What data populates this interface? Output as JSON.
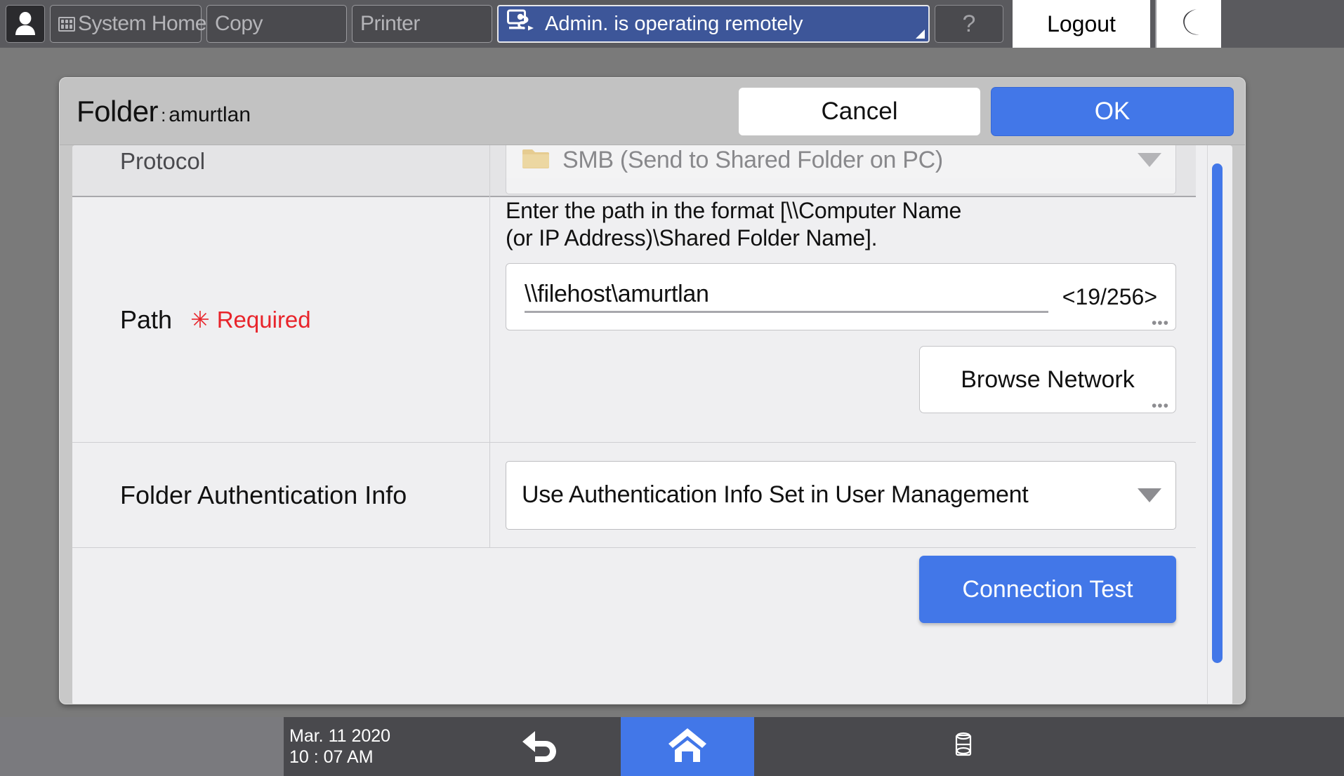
{
  "topbar": {
    "user_icon": "person-icon",
    "tabs": [
      {
        "label": "System Home",
        "icon": "grid-icon"
      },
      {
        "label": "Copy",
        "icon": null
      },
      {
        "label": "Printer",
        "icon": null
      }
    ],
    "remote_banner": {
      "text": "Admin. is operating remotely",
      "icon": "remote-operation-icon",
      "bg_color": "#3d5699"
    },
    "help_label": "?",
    "logout_label": "Logout",
    "sleep_icon": "moon-icon"
  },
  "dialog": {
    "title_main": "Folder",
    "title_separator": ":",
    "title_sub": "amurtlan",
    "cancel_label": "Cancel",
    "ok_label": "OK",
    "ok_color": "#4277e8",
    "rows": {
      "protocol": {
        "label": "Protocol",
        "value": "SMB (Send to Shared Folder on PC)",
        "icon": "folder-icon",
        "caret": "chevron-down-icon"
      },
      "path": {
        "label": "Path",
        "required_marker": "✳",
        "required_text": "Required",
        "required_color": "#e8242b",
        "hint_line1": "Enter the path in the format [\\\\Computer Name",
        "hint_line2": "(or IP Address)\\Shared Folder Name].",
        "value": "\\\\filehost\\amurtlan",
        "counter": "<19/256>",
        "overflow_mark": "•••",
        "browse_label": "Browse Network",
        "browse_overflow_mark": "•••"
      },
      "auth": {
        "label": "Folder Authentication Info",
        "value": "Use Authentication Info Set in User Management",
        "caret": "chevron-down-icon"
      },
      "test": {
        "connection_test_label": "Connection Test",
        "color": "#4277e8"
      }
    },
    "scrollbar": {
      "thumb_color": "#4277e8"
    }
  },
  "bottombar": {
    "date": "Mar. 11 2020",
    "time": "10 : 07 AM",
    "back_icon": "back-arrow-icon",
    "home_icon": "home-icon",
    "home_color": "#4277e8",
    "stored_icon": "stored-files-icon"
  }
}
